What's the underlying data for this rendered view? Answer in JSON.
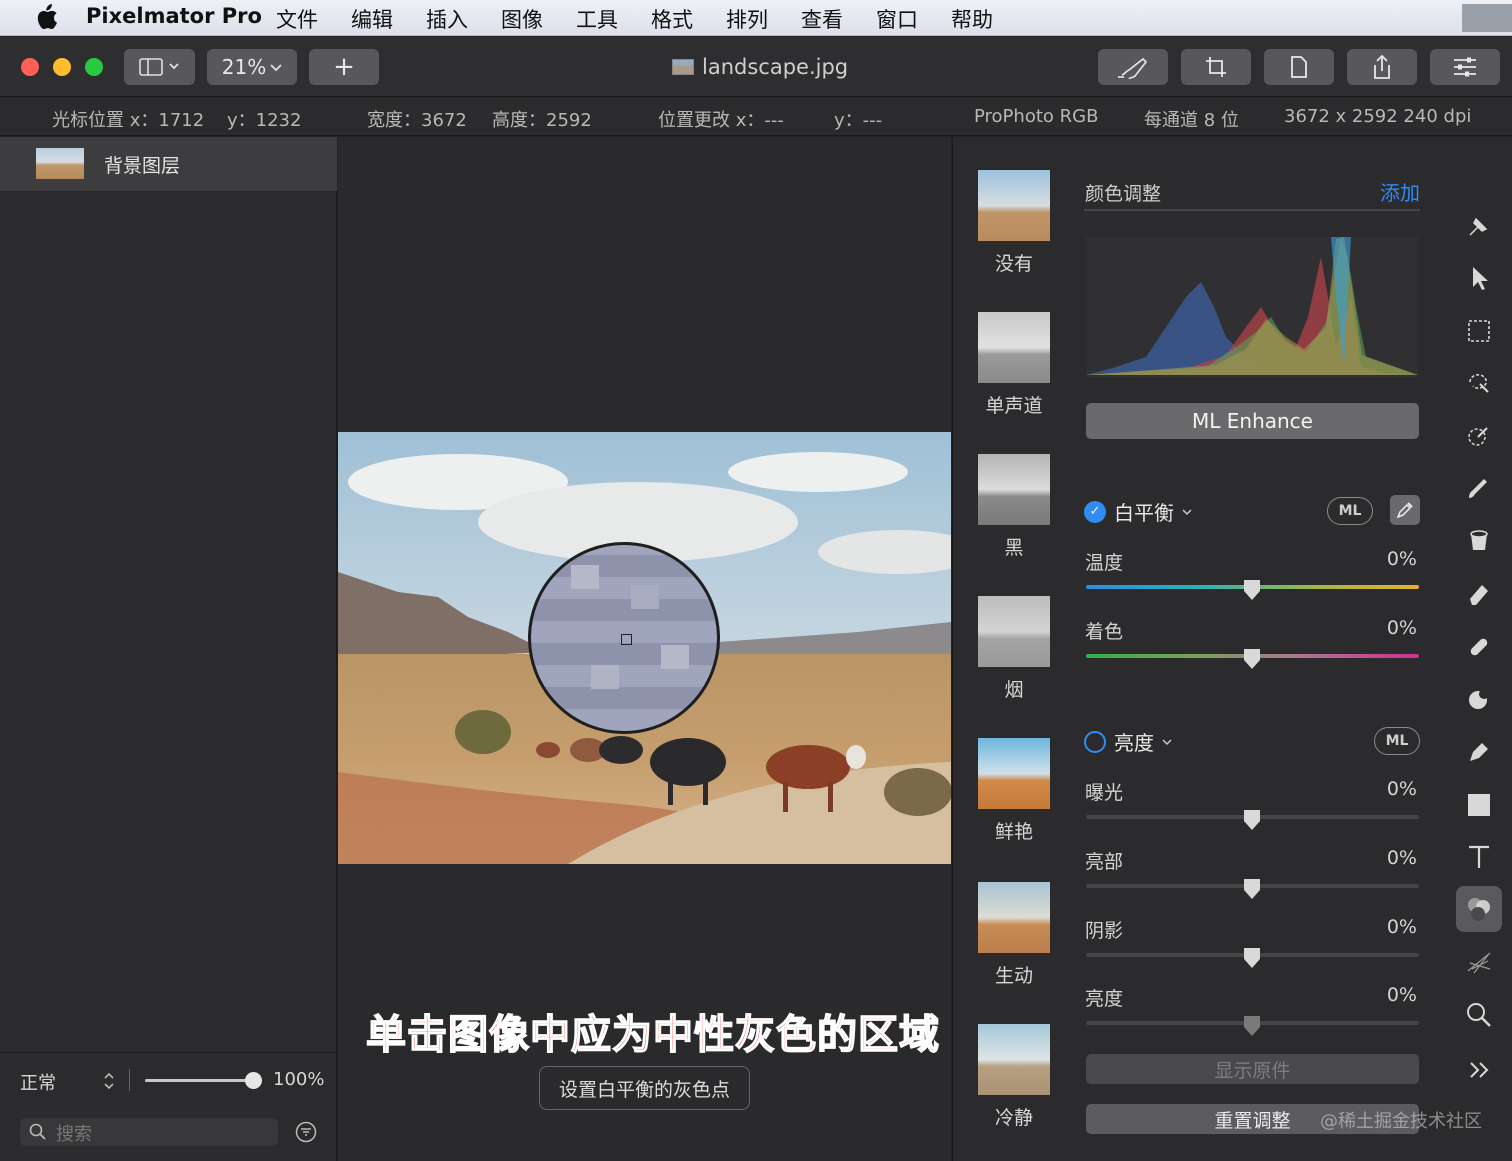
{
  "menubar": {
    "app_name": "Pixelmator Pro",
    "items": [
      "文件",
      "编辑",
      "插入",
      "图像",
      "工具",
      "格式",
      "排列",
      "查看",
      "窗口",
      "帮助"
    ]
  },
  "toolbar": {
    "zoom": "21%",
    "add_label": "+",
    "document_title": "landscape.jpg"
  },
  "info": {
    "cursor_x": "光标位置 x：1712",
    "cursor_y": "y：1232",
    "width": "宽度：3672",
    "height": "高度：2592",
    "pos_change_x": "位置更改 x：---",
    "pos_change_y": "y：---",
    "color_profile": "ProPhoto RGB",
    "bit_depth": "每通道 8 位",
    "dimensions": "3672 x 2592 240 dpi"
  },
  "layers": {
    "items": [
      {
        "name": "背景图层"
      }
    ],
    "blend_mode": "正常",
    "opacity": "100%",
    "opacity_fraction": 1.0,
    "search_placeholder": "搜索"
  },
  "canvas": {
    "tutorial_caption": "单击图像中应为中性灰色的区域",
    "tooltip": "设置白平衡的灰色点"
  },
  "presets": [
    "没有",
    "单声道",
    "黑",
    "烟",
    "鲜艳",
    "生动",
    "冷静"
  ],
  "adjust": {
    "title": "颜色调整",
    "add_label": "添加",
    "ml_enhance": "ML Enhance",
    "white_balance": {
      "label": "白平衡",
      "enabled": true,
      "ml": "ML",
      "rows": [
        {
          "label": "温度",
          "value": "0%"
        },
        {
          "label": "着色",
          "value": "0%"
        }
      ]
    },
    "lightness": {
      "label": "亮度",
      "enabled": false,
      "ml": "ML",
      "rows": [
        {
          "label": "曝光",
          "value": "0%"
        },
        {
          "label": "亮部",
          "value": "0%"
        },
        {
          "label": "阴影",
          "value": "0%"
        },
        {
          "label": "亮度",
          "value": "0%"
        }
      ]
    },
    "show_original": "显示原件",
    "reset": "重置调整"
  },
  "watermark": "@稀土掘金技术社区",
  "colors": {
    "accent": "#2f8cf0",
    "close": "#ff5f57",
    "minimize": "#febc2e",
    "zoom": "#28c840",
    "caption": "#e8322d"
  },
  "icons": {
    "tools": [
      "arrange-icon",
      "select-arrow-icon",
      "rect-select-icon",
      "magic-select-icon",
      "color-picker-icon",
      "brush-icon",
      "fill-icon",
      "eraser-icon",
      "repair-icon",
      "distort-icon",
      "pen-icon",
      "shape-icon",
      "text-icon",
      "color-adjust-icon",
      "effects-icon",
      "zoom-icon",
      "more-icon"
    ]
  }
}
